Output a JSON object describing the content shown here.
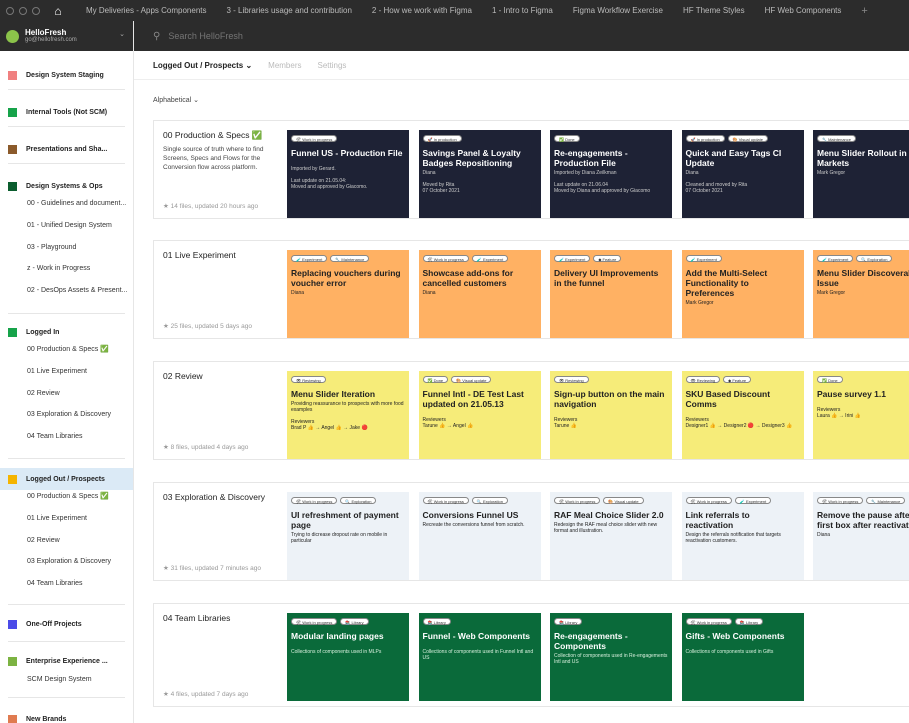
{
  "tabbar": {
    "tabs": [
      "My Deliveries - Apps Components",
      "3 - Libraries usage and contribution",
      "2 - How we work with Figma",
      "1 - Intro to Figma",
      "Figma Workflow Exercise",
      "HF Theme Styles",
      "HF Web Components"
    ],
    "plus": "+"
  },
  "team": {
    "name": "HelloFresh",
    "email": "go@hellofresh.com",
    "chevron": "⌄"
  },
  "search": {
    "placeholder": "Search HelloFresh"
  },
  "sidebar": {
    "projects": [
      {
        "label": "Design System Staging",
        "color": "#f08080"
      },
      {
        "label": "Internal Tools (Not SCM)",
        "color": "#16a34a"
      },
      {
        "label": "Presentations and Sha...",
        "color": "#8b5a2b"
      },
      {
        "label": "Design Systems & Ops",
        "color": "#0b5d2e",
        "subs": [
          "00 - Guidelines and document...",
          "01 - Unified Design System",
          "03 - Playground",
          "z - Work in Progress",
          "02 - DesOps Assets & Present..."
        ]
      },
      {
        "label": "Logged In",
        "color": "#16a34a",
        "subs": [
          "00 Production & Specs ✅",
          "01 Live Experiment",
          "02 Review",
          "03 Exploration & Discovery",
          "04 Team Libraries"
        ]
      },
      {
        "label": "Logged Out / Prospects",
        "color": "#f5b400",
        "subs": [
          "00 Production & Specs ✅",
          "01 Live Experiment",
          "02 Review",
          "03 Exploration & Discovery",
          "04 Team Libraries"
        ]
      },
      {
        "label": "One-Off Projects",
        "color": "#4b4be8"
      },
      {
        "label": "Enterprise Experience ...",
        "color": "#7cb342",
        "subs": [
          "SCM Design System"
        ]
      },
      {
        "label": "New Brands",
        "color": "#e07b50"
      }
    ]
  },
  "page": {
    "tabs": [
      "Logged Out / Prospects ⌄",
      "Members",
      "Settings"
    ],
    "sort": "Alphabetical ⌄"
  },
  "sections": [
    {
      "title": "00 Production & Specs ✅",
      "desc": "Single source of truth where to find Screens, Specs and Flows for the Conversion flow across platform.",
      "meta": "★  14 files, updated 20 hours ago",
      "style": "cdark",
      "cards": [
        {
          "tags": [
            "🛠 Work in progress"
          ],
          "title": "Funnel US - Production File",
          "lines": [
            "",
            "Imported by Gerard.",
            "",
            "Last update on 21.05.04:",
            "Moved and approved by Giacomo."
          ]
        },
        {
          "tags": [
            "🚀 In production"
          ],
          "title": "Savings Panel & Loyalty Badges Repositioning",
          "lines": [
            "Diana",
            "",
            "Moved by Rita",
            "07 October 2021"
          ]
        },
        {
          "tags": [
            "✅ Done"
          ],
          "title": "Re-engagements - Production File",
          "lines": [
            "Imported by Diana Zeilkman",
            "",
            "Last update on 21.06.04",
            "Moved by Diana and approved by Giacomo"
          ]
        },
        {
          "tags": [
            "🚀 In production",
            "🎨 Visual update"
          ],
          "title": "Quick and Easy Tags CI Update",
          "lines": [
            "Diana",
            "",
            "Cleaned and moved by Rita",
            "07 October 2021"
          ]
        },
        {
          "tags": [
            "🔧 Maintenance"
          ],
          "title": "Menu Slider Rollout in Markets",
          "lines": [
            "Mark Gregor"
          ]
        }
      ]
    },
    {
      "title": "01 Live Experiment",
      "desc": "",
      "meta": "★  25 files, updated 5 days ago",
      "style": "corange",
      "cards": [
        {
          "tags": [
            "🧪 Experiment",
            "🔧 Maintenance"
          ],
          "title": "Replacing vouchers during voucher error",
          "lines": [
            "Diana"
          ]
        },
        {
          "tags": [
            "🛠 Work in progress",
            "🧪 Experiment"
          ],
          "title": "Showcase add-ons for cancelled customers",
          "lines": [
            "Diana"
          ]
        },
        {
          "tags": [
            "🧪 Experiment",
            "◆ Feature"
          ],
          "title": "Delivery UI Improvements in the funnel",
          "lines": []
        },
        {
          "tags": [
            "🧪 Experiment"
          ],
          "title": "Add the Multi-Select Functionality to Preferences",
          "lines": [
            "Mark Gregor"
          ]
        },
        {
          "tags": [
            "🧪 Experiment",
            "🔍 Exploration"
          ],
          "title": "Menu Slider Discoverability Issue",
          "lines": [
            "Mark Gregor"
          ]
        }
      ]
    },
    {
      "title": "02 Review",
      "desc": "",
      "meta": "★  8 files, updated 4 days ago",
      "style": "cyellow",
      "cards": [
        {
          "tags": [
            "👁 Reviewing"
          ],
          "title": "Menu Slider Iteration",
          "lines": [
            "Providing reassurance to prospects with more food examples",
            "",
            "Reviewers",
            "Brad P 👍 → Angel 👍 → Jake 🔴"
          ]
        },
        {
          "tags": [
            "✅ Done",
            "🎨 Visual update"
          ],
          "title": "Funnel Intl - DE Test Last updated on 21.05.13",
          "lines": [
            "",
            "Reviewers",
            "Tarune 👍 → Angel 👍"
          ]
        },
        {
          "tags": [
            "👁 Reviewing"
          ],
          "title": "Sign-up button on the main navigation",
          "lines": [
            "",
            "Reviewers",
            "Tarune 👍"
          ]
        },
        {
          "tags": [
            "👁 Reviewing",
            "◆ Feature"
          ],
          "title": "SKU Based Discount Comms",
          "lines": [
            "",
            "Reviewers",
            "Designer1 👍 → Designer2 🔴 → Designer3 👍"
          ]
        },
        {
          "tags": [
            "✅ Done"
          ],
          "title": "Pause survey 1.1",
          "lines": [
            "",
            "Reviewers",
            "Laura 👍 → Irini 👍"
          ]
        }
      ]
    },
    {
      "title": "03 Exploration & Discovery",
      "desc": "",
      "meta": "★  31 files, updated 7 minutes ago",
      "style": "cpale",
      "cards": [
        {
          "tags": [
            "🛠 Work in progress",
            "🔍 Exploration"
          ],
          "title": "UI refreshment of payment page",
          "lines": [
            "Trying to dicrease dropout rate on mobile in particular"
          ]
        },
        {
          "tags": [
            "🛠 Work in progress",
            "🔍 Exploration"
          ],
          "title": "Conversions Funnel US",
          "lines": [
            "Recreate the conversions funnel from scratch."
          ]
        },
        {
          "tags": [
            "🛠 Work in progress",
            "🎨 Visual update"
          ],
          "title": "RAF Meal Choice Slider 2.0",
          "lines": [
            "Redesign the RAF meal choice slider with new format and illustration."
          ]
        },
        {
          "tags": [
            "🛠 Work in progress",
            "🧪 Experiment"
          ],
          "title": "Link referrals to reactivation",
          "lines": [
            "Design the referrals notification that targets reactivation customers."
          ]
        },
        {
          "tags": [
            "🛠 Work in progress",
            "🔧 Maintenance"
          ],
          "title": "Remove the pause after first box after reactivation",
          "lines": [
            "Diana"
          ]
        }
      ]
    },
    {
      "title": "04 Team Libraries",
      "desc": "",
      "meta": "★  4 files, updated 7 days ago",
      "style": "cgreen",
      "cards": [
        {
          "tags": [
            "🛠 Work in progress",
            "📚 Library"
          ],
          "title": "Modular landing pages",
          "lines": [
            "",
            "Collections of components used in MLPs"
          ]
        },
        {
          "tags": [
            "📚 Library"
          ],
          "title": "Funnel - Web Components",
          "lines": [
            "",
            "Collections of components used in Funnel Intl and US"
          ]
        },
        {
          "tags": [
            "📚 Library"
          ],
          "title": "Re-engagements - Components",
          "lines": [
            "Collection of components used in Re-engagements Intl and US"
          ]
        },
        {
          "tags": [
            "🛠 Work in progress",
            "📚 Library"
          ],
          "title": "Gifts - Web Components",
          "lines": [
            "",
            "Collections of components used in Gifts"
          ]
        }
      ]
    }
  ]
}
